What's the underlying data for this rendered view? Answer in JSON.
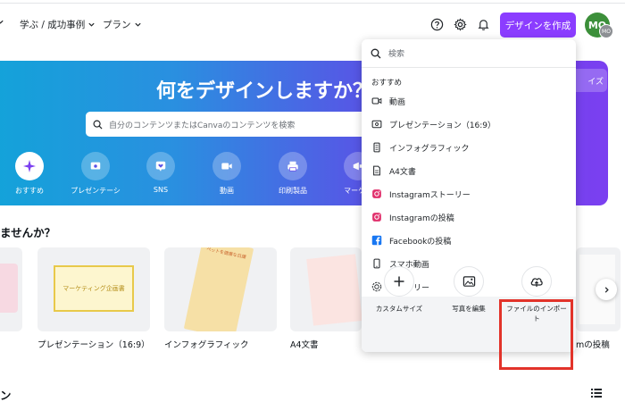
{
  "nav": {
    "learn": "学ぶ / 成功事例",
    "plans": "プラン"
  },
  "header": {
    "design_button": "デザインを作成",
    "avatar_initials": "MO",
    "avatar_badge": "MO"
  },
  "hero": {
    "title": "何をデザインしますか？",
    "search_placeholder": "自分のコンテンツまたはCanvaのコンテンツを検索",
    "right_pill": "イズ",
    "categories": [
      {
        "label": "おすすめ",
        "icon": "sparkle-icon"
      },
      {
        "label": "プレゼンテーシ",
        "icon": "presentation-icon"
      },
      {
        "label": "SNS",
        "icon": "heart-bubble-icon"
      },
      {
        "label": "動画",
        "icon": "video-icon"
      },
      {
        "label": "印刷製品",
        "icon": "printer-icon"
      },
      {
        "label": "マーケテ",
        "icon": "megaphone-icon"
      }
    ]
  },
  "section": {
    "title": "ませんか？",
    "bottom_title": "ン"
  },
  "cards": [
    {
      "label": ""
    },
    {
      "label": "プレゼンテーション（16:9）",
      "thumb_title": "マーケティング企画書"
    },
    {
      "label": "インフォグラフィック",
      "thumb_title": "ペットを健康な日課"
    },
    {
      "label": "A4文書"
    },
    {
      "label": "mの投稿"
    }
  ],
  "dropdown": {
    "search_placeholder": "検索",
    "heading": "おすすめ",
    "items": [
      {
        "label": "動画",
        "icon": "video-icon"
      },
      {
        "label": "プレゼンテーション（16:9）",
        "icon": "presentation-icon"
      },
      {
        "label": "インフォグラフィック",
        "icon": "infographic-icon"
      },
      {
        "label": "A4文書",
        "icon": "document-icon"
      },
      {
        "label": "Instagramストーリー",
        "icon": "instagram-icon"
      },
      {
        "label": "Instagramの投稿",
        "icon": "instagram-icon"
      },
      {
        "label": "Facebookの投稿",
        "icon": "facebook-icon"
      },
      {
        "label": "スマホ動画",
        "icon": "phone-icon"
      },
      {
        "label": "ストーリー",
        "icon": "story-icon"
      }
    ],
    "actions": [
      {
        "label": "カスタムサイズ",
        "icon": "plus-icon"
      },
      {
        "label": "写真を編集",
        "icon": "photo-edit-icon"
      },
      {
        "label": "ファイルのインポート",
        "icon": "upload-cloud-icon"
      }
    ]
  },
  "colors": {
    "brand_purple": "#8b3dff",
    "highlight_red": "#e2332a",
    "hero_gradient_start": "#13a3d9",
    "hero_gradient_end": "#7b3ff0"
  }
}
